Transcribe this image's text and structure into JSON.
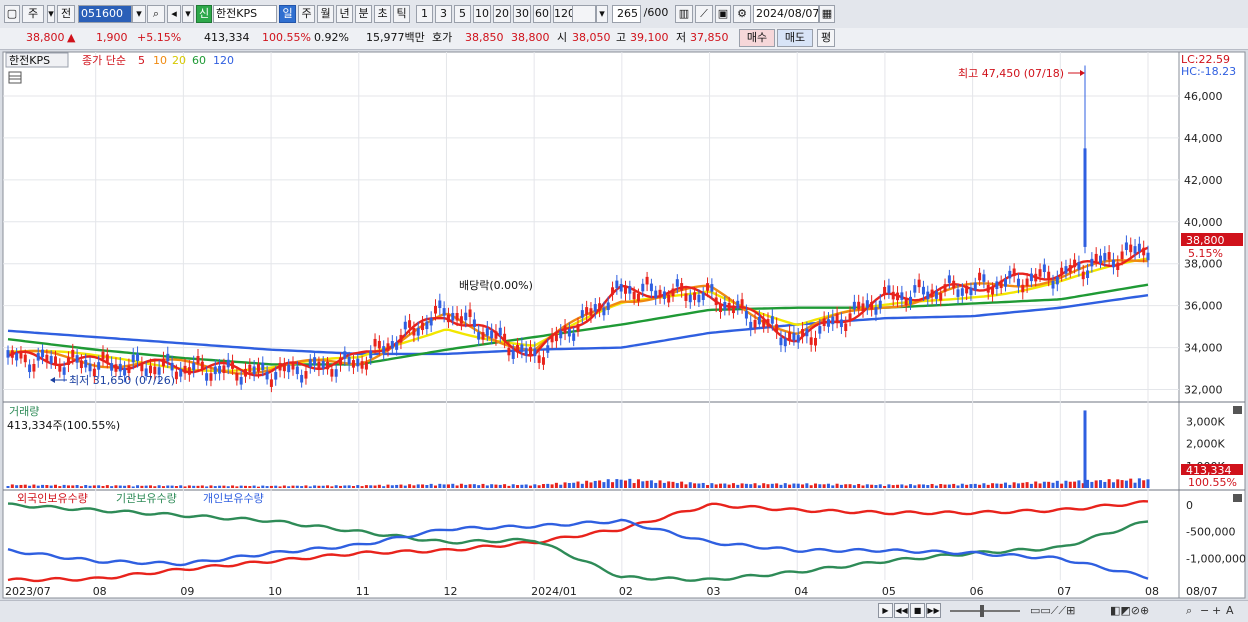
{
  "toolbar": {
    "period_mode": "주",
    "prev_label": "전",
    "stock_code": "051600",
    "new_badge": "신",
    "stock_name": "한전KPS",
    "period_tabs": [
      "일",
      "주",
      "월",
      "년",
      "분",
      "초",
      "틱"
    ],
    "active_period": "일",
    "interval_buttons": [
      "1",
      "3",
      "5",
      "10",
      "20",
      "30",
      "60",
      "120"
    ],
    "count_display": "265",
    "count_max": "/600",
    "date": "2024/08/07"
  },
  "quote": {
    "price": "38,800",
    "change": "1,900",
    "change_pct": "+5.15%",
    "volume": "413,334",
    "volume_ratio": "100.55%",
    "turnover": "0.92%",
    "trade_value": "15,977백만",
    "ask_label": "호가",
    "ask": "38,850",
    "bid": "38,800",
    "open_label": "시",
    "open": "38,050",
    "high_label": "고",
    "high": "39,100",
    "low_label": "저",
    "low": "37,850",
    "buy_label": "매수",
    "sell_label": "매도",
    "eval_label": "평"
  },
  "price_panel": {
    "name": "한전KPS",
    "legend": {
      "label": "종가 단순",
      "periods": [
        "5",
        "10",
        "20",
        "60",
        "120"
      ]
    },
    "lc": "LC:22.59",
    "hc": "HC:-18.23",
    "high_annotation": "최고 47,450 (07/18)",
    "low_annotation": "최저 31,650 (07/26)",
    "dividend_annotation": "배당락(0.00%)",
    "current_price_tag": "38,800",
    "current_pct_tag": "5.15%",
    "y_ticks": [
      "46,000",
      "44,000",
      "42,000",
      "40,000",
      "38,000",
      "36,000",
      "34,000",
      "32,000"
    ]
  },
  "volume_panel": {
    "title": "거래량",
    "info": "413,334주(100.55%)",
    "y_ticks": [
      "3,000K",
      "2,000K",
      "1,000K"
    ],
    "current_tag": "413,334",
    "current_pct": "100.55%"
  },
  "holdings_panel": {
    "legend": [
      "외국인보유수량",
      "기관보유수량",
      "개인보유수량"
    ],
    "y_ticks": [
      "0",
      "-500,000",
      "-1,000,000"
    ]
  },
  "x_axis": {
    "labels": [
      "2023/07",
      "08",
      "09",
      "10",
      "11",
      "12",
      "2024/01",
      "02",
      "03",
      "04",
      "05",
      "06",
      "07",
      "08"
    ],
    "right_label": "08/07"
  },
  "chart_data": {
    "type": "line",
    "months": [
      "2023/07",
      "08",
      "09",
      "10",
      "11",
      "12",
      "2024/01",
      "02",
      "03",
      "04",
      "05",
      "06",
      "07",
      "08"
    ],
    "price_ylim": [
      31500,
      48000
    ],
    "close_approx": [
      33500,
      33200,
      33000,
      32800,
      33300,
      35800,
      33500,
      36800,
      36500,
      34300,
      36400,
      36900,
      37500,
      38800
    ],
    "ma": [
      {
        "name": "5",
        "values": [
          33600,
          33300,
          33100,
          32900,
          33500,
          35600,
          33700,
          36700,
          36600,
          34400,
          36300,
          36900,
          37600,
          38500
        ]
      },
      {
        "name": "10",
        "values": [
          33700,
          33350,
          33150,
          32950,
          33400,
          35400,
          33900,
          36400,
          36700,
          34700,
          36100,
          36800,
          37400,
          38300
        ]
      },
      {
        "name": "20",
        "values": [
          33800,
          33400,
          33200,
          33050,
          33300,
          35100,
          34100,
          35900,
          36900,
          35100,
          35800,
          36600,
          37200,
          38000
        ]
      },
      {
        "name": "60",
        "values": [
          34400,
          33900,
          33500,
          33200,
          33200,
          33900,
          34500,
          35100,
          35800,
          35900,
          35900,
          36100,
          36300,
          37000
        ]
      },
      {
        "name": "120",
        "values": [
          34800,
          34500,
          34200,
          33900,
          33700,
          33700,
          33900,
          34000,
          34700,
          35100,
          35400,
          35500,
          35900,
          36500
        ]
      }
    ],
    "volume_approx_k": [
      150,
      120,
      110,
      100,
      120,
      180,
      150,
      400,
      200,
      200,
      150,
      180,
      300,
      413
    ],
    "volume_spike_k": 3500,
    "volume_ylim": [
      0,
      3700
    ],
    "holdings_ylim": [
      -1400000,
      200000
    ],
    "holdings": [
      {
        "name": "외국인보유수량",
        "values": [
          -1400000,
          -1380000,
          -1200000,
          -1050000,
          -900000,
          -850000,
          -700000,
          -450000,
          0,
          -100000,
          -150000,
          -150000,
          -100000,
          50000
        ]
      },
      {
        "name": "기관보유수량",
        "values": [
          0,
          -100000,
          -200000,
          -300000,
          -500000,
          -700000,
          -650000,
          -1350000,
          -1400000,
          -1250000,
          -1050000,
          -900000,
          -800000,
          -300000
        ]
      },
      {
        "name": "개인보유수량",
        "values": [
          -850000,
          -1050000,
          -1100000,
          -900000,
          -750000,
          -450000,
          -400000,
          -300000,
          -700000,
          -850000,
          -850000,
          -900000,
          -1000000,
          -1350000
        ]
      }
    ],
    "colors": {
      "5": "#e8231c",
      "10": "#f08a10",
      "20": "#f2e600",
      "60": "#1f9a35",
      "120": "#2f5fe0",
      "foreign": "#e8231c",
      "inst": "#2e8b57",
      "indiv": "#2f5fe0"
    }
  }
}
